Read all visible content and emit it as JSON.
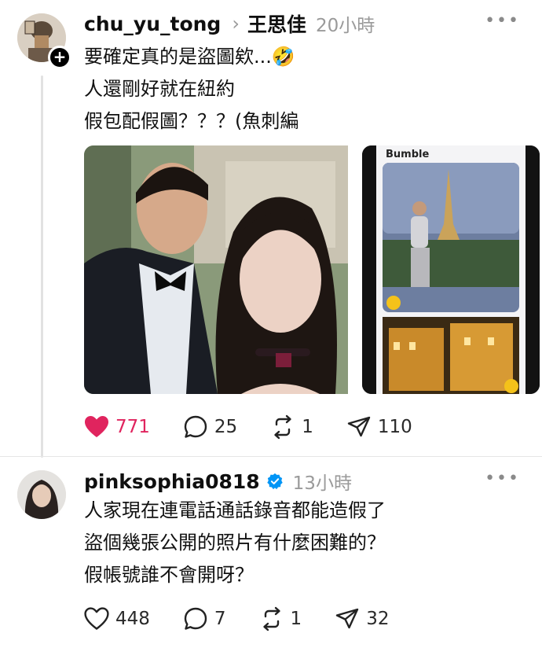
{
  "post1": {
    "username": "chu_yu_tong",
    "reply_to": "王思佳",
    "time": "20小時",
    "text": "要確定真的是盜圖欸...🤣\n人還剛好就在紐約\n假包配假圖？？？(魚刺編",
    "bumble_label": "Bumble",
    "likes": "771",
    "replies": "25",
    "reposts": "1",
    "shares": "110",
    "more": "•••"
  },
  "post2": {
    "username": "pinksophia0818",
    "time": "13小時",
    "text": "人家現在連電話通話錄音都能造假了\n盜個幾張公開的照片有什麼困難的？\n假帳號誰不會開呀？",
    "likes": "448",
    "replies": "7",
    "reposts": "1",
    "shares": "32",
    "more": "•••"
  },
  "icons": {
    "chevron": "›",
    "plus": "+"
  },
  "colors": {
    "like_active": "#e0245e",
    "verified": "#0095f6",
    "meta_gray": "#9a9a9a"
  }
}
